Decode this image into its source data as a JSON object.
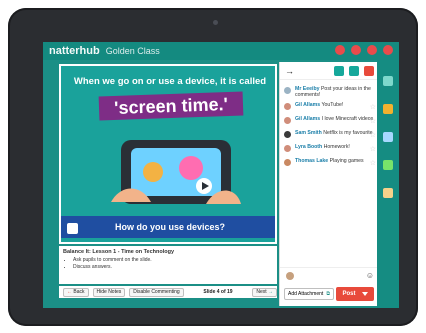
{
  "app": {
    "brand": "natterhub",
    "class_name": "Golden Class"
  },
  "slide": {
    "headline": "When we go on or use a device, it is called",
    "highlight": "'screen time.'",
    "question": "How do you use devices?"
  },
  "notes": {
    "title": "Balance It: Lesson 1 - Time on Technology",
    "bullets": [
      "Ask pupils to comment on the slide.",
      "Discuss answers."
    ]
  },
  "bottombar": {
    "back_label": "Back",
    "hide_notes_label": "Hide Notes",
    "disable_commenting_label": "Disable Commenting",
    "slide_counter": "Slide 4 of 19",
    "next_label": "Next"
  },
  "comments_panel": {
    "back_arrow": "→",
    "comments": [
      {
        "name": "Mr Eeeiby",
        "text": "Post your ideas in the comments!"
      },
      {
        "name": "Gil Allams",
        "text": "YouTube!"
      },
      {
        "name": "Gil Allams",
        "text": "I love Minecraft videos"
      },
      {
        "name": "Sam Smith",
        "text": "Netflix is my favourite"
      },
      {
        "name": "Lyra Booth",
        "text": "Homework!"
      },
      {
        "name": "Thomas Lake",
        "text": "Playing games"
      }
    ],
    "composer": {
      "add_attachment_label": "Add Attachment",
      "post_label": "Post"
    }
  },
  "colors": {
    "teal": "#1b8f86",
    "purple": "#7e2d86",
    "blue": "#1f4ea1",
    "red": "#e84a3b",
    "name_blue": "#1b7fa9"
  },
  "icons": {
    "topbar": [
      "bell-icon",
      "chat-icon",
      "heart-icon",
      "cog-icon"
    ],
    "comment_header": [
      "settings-icon",
      "grid-icon",
      "close-icon"
    ],
    "composer": [
      "emoji-icon",
      "attachment-icon"
    ]
  }
}
